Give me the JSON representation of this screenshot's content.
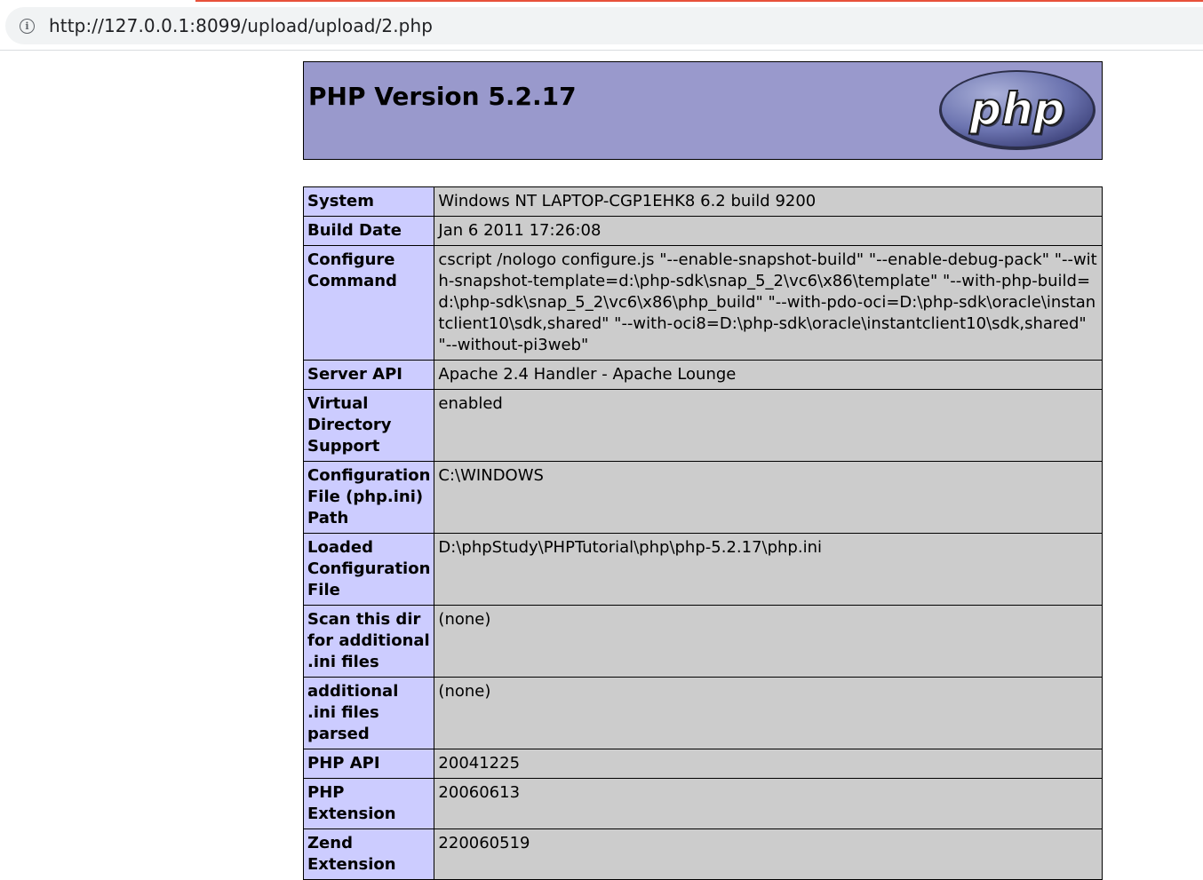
{
  "browser": {
    "url": "http://127.0.0.1:8099/upload/upload/2.php",
    "info_icon": "info-icon"
  },
  "header": {
    "title": "PHP Version 5.2.17",
    "logo_text": "php"
  },
  "rows": [
    {
      "label": "System",
      "value": "Windows NT LAPTOP-CGP1EHK8 6.2 build 9200"
    },
    {
      "label": "Build Date",
      "value": "Jan 6 2011 17:26:08"
    },
    {
      "label": "Configure Command",
      "value": "cscript /nologo configure.js \"--enable-snapshot-build\" \"--enable-debug-pack\" \"--with-snapshot-template=d:\\php-sdk\\snap_5_2\\vc6\\x86\\template\" \"--with-php-build=d:\\php-sdk\\snap_5_2\\vc6\\x86\\php_build\" \"--with-pdo-oci=D:\\php-sdk\\oracle\\instantclient10\\sdk,shared\" \"--with-oci8=D:\\php-sdk\\oracle\\instantclient10\\sdk,shared\" \"--without-pi3web\""
    },
    {
      "label": "Server API",
      "value": "Apache 2.4 Handler - Apache Lounge"
    },
    {
      "label": "Virtual Directory Support",
      "value": "enabled"
    },
    {
      "label": "Configuration File (php.ini) Path",
      "value": "C:\\WINDOWS"
    },
    {
      "label": "Loaded Configuration File",
      "value": "D:\\phpStudy\\PHPTutorial\\php\\php-5.2.17\\php.ini"
    },
    {
      "label": "Scan this dir for additional .ini files",
      "value": "(none)"
    },
    {
      "label": "additional .ini files parsed",
      "value": "(none)"
    },
    {
      "label": "PHP API",
      "value": "20041225"
    },
    {
      "label": "PHP Extension",
      "value": "20060613"
    },
    {
      "label": "Zend Extension",
      "value": "220060519"
    }
  ],
  "colors": {
    "header_bg": "#9999cc",
    "label_bg": "#ccccff",
    "value_bg": "#cccccc",
    "tab_accent": "#e8513a"
  }
}
